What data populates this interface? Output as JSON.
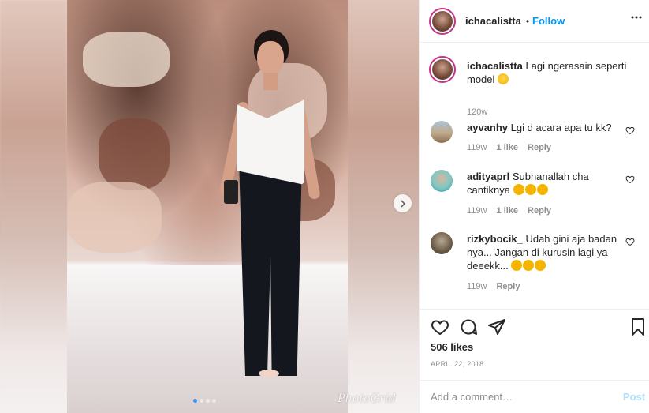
{
  "header": {
    "username": "ichacalistta",
    "separator": "•",
    "follow_label": "Follow",
    "more_label": "···"
  },
  "caption": {
    "username": "ichacalistta",
    "text": "Lagi ngerasain seperti model",
    "emoji": "rolling-on-floor-laughing",
    "time": "120w"
  },
  "comments": [
    {
      "username": "ayvanhy",
      "text": "Lgi d acara apa tu kk?",
      "time": "119w",
      "likes": "1 like",
      "reply": "Reply"
    },
    {
      "username": "adityaprl",
      "text": "Subhanallah cha cantiknya",
      "emoji": "heart-eyes x3",
      "time": "119w",
      "likes": "1 like",
      "reply": "Reply"
    },
    {
      "username": "rizkybocik_",
      "text": "Udah gini aja badan nya... Jangan di kurusin lagi ya deeekk...",
      "emoji": "anguished x3",
      "time": "119w",
      "reply": "Reply"
    }
  ],
  "likes": "506 likes",
  "date": "APRIL 22, 2018",
  "add_comment": {
    "placeholder": "Add a comment…",
    "post_label": "Post"
  },
  "media": {
    "watermark": "PhotoGrid",
    "carousel_dots": 4,
    "active_dot": 1
  },
  "icons": {
    "like": "heart-outline-icon",
    "comment": "comment-bubble-icon",
    "share": "paper-plane-icon",
    "save": "bookmark-icon",
    "next": "chevron-right-icon"
  },
  "colors": {
    "follow": "#0095f6",
    "secondary_text": "#8e8e8e",
    "avatar_ring": "#c13584",
    "carousel_active": "#3897f0"
  }
}
